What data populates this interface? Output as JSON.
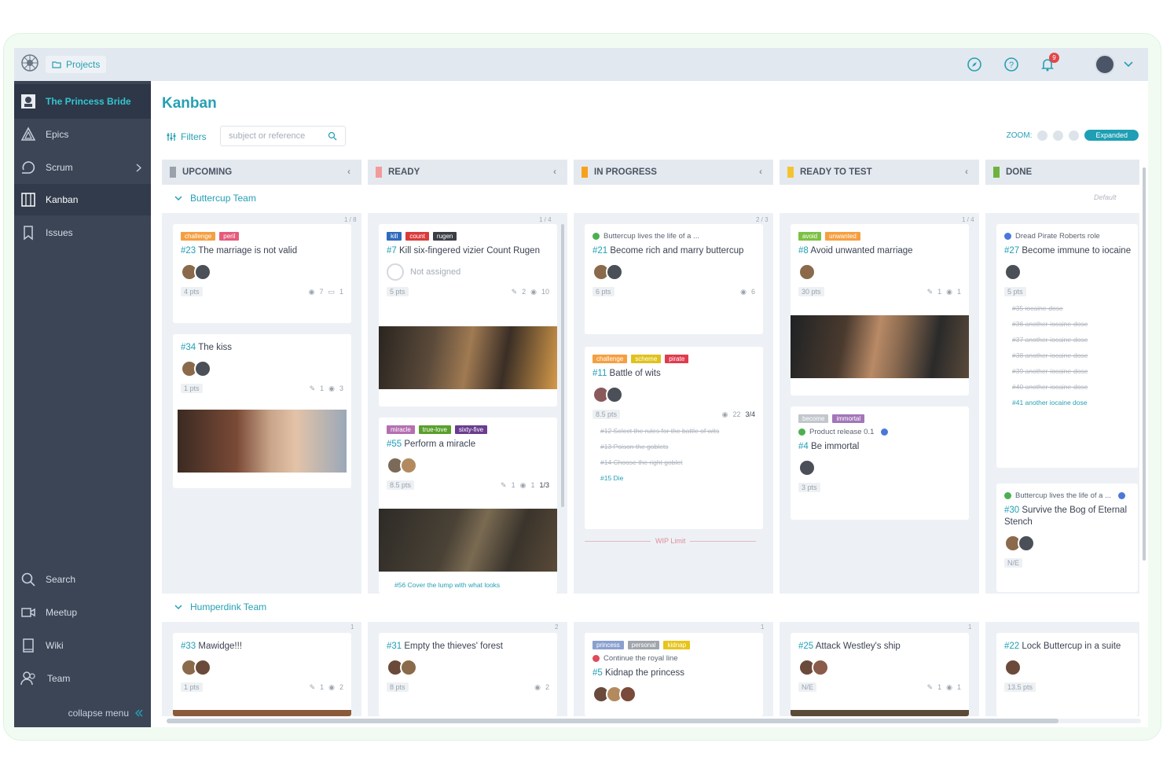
{
  "topbar": {
    "projects_label": "Projects",
    "notifications_count": "9"
  },
  "sidebar": {
    "project_name": "The Princess Bride",
    "items": [
      "Epics",
      "Scrum",
      "Kanban",
      "Issues"
    ],
    "bottom_items": [
      "Search",
      "Meetup",
      "Wiki",
      "Team"
    ],
    "collapse_label": "collapse menu"
  },
  "main": {
    "title": "Kanban",
    "filters_label": "Filters",
    "search_placeholder": "subject or reference",
    "zoom_label": "ZOOM:",
    "zoom_value": "Expanded"
  },
  "columns": [
    {
      "name": "UPCOMING",
      "color": "#9aa1aa"
    },
    {
      "name": "READY",
      "color": "#f29b9b"
    },
    {
      "name": "IN PROGRESS",
      "color": "#f7a21b"
    },
    {
      "name": "READY TO TEST",
      "color": "#f4c430"
    },
    {
      "name": "DONE",
      "color": "#6fb33f"
    }
  ],
  "swimlanes": [
    "Buttercup Team",
    "Humperdink Team"
  ],
  "default_label": "Default",
  "wip_label": "WIP Limit",
  "counters": [
    "1 / 8",
    "1 / 4",
    "2 / 3",
    "1 / 4",
    "1",
    "2",
    "1",
    "1"
  ],
  "cards": {
    "c23": {
      "tags": [
        "challenge",
        "peril"
      ],
      "ref": "#23",
      "title": "The marriage is not valid",
      "pts": "4 pts",
      "watchers": "7",
      "comments": "1"
    },
    "c34": {
      "ref": "#34",
      "title": "The kiss",
      "pts": "1 pts",
      "attachments": "1",
      "watchers": "3"
    },
    "c7": {
      "tags": [
        "kill",
        "count",
        "rugen"
      ],
      "ref": "#7",
      "title": "Kill six-fingered vizier Count Rugen",
      "assigned": "Not assigned",
      "pts": "5 pts",
      "attachments": "2",
      "watchers": "10"
    },
    "c55": {
      "tags": [
        "miracle",
        "true-love",
        "sixty-five"
      ],
      "ref": "#55",
      "title": "Perform a miracle",
      "pts": "8.5 pts",
      "attachments": "1",
      "watchers": "1",
      "tasks": "1/3",
      "subtask": "#56 Cover the lump with what looks"
    },
    "c21": {
      "epic": "Buttercup lives the life of a ...",
      "ref": "#21",
      "title": "Become rich and marry buttercup",
      "pts": "6 pts",
      "watchers": "6"
    },
    "c11": {
      "tags": [
        "challenge",
        "scheme",
        "pirate"
      ],
      "ref": "#11",
      "title": "Battle of wits",
      "pts": "8.5 pts",
      "watchers": "22",
      "tasks": "3/4",
      "subtasks": [
        "#12 Select the rules for the battle of wits",
        "#13 Poison the goblets",
        "#14 Choose the right goblet",
        "#15 Die"
      ]
    },
    "c8": {
      "tags": [
        "avoid",
        "unwanted"
      ],
      "ref": "#8",
      "title": "Avoid unwanted marriage",
      "pts": "30 pts",
      "attachments": "1",
      "watchers": "1"
    },
    "c4": {
      "tags": [
        "become",
        "immortal"
      ],
      "epic": "Product release 0.1",
      "ref": "#4",
      "title": "Be immortal",
      "pts": "3 pts"
    },
    "c27": {
      "epic": "Dread Pirate Roberts role",
      "ref": "#27",
      "title": "Become immune to iocaine",
      "pts": "5 pts",
      "subtasks": [
        "#35 iocaine-dose",
        "#36 another-iocaine-dose",
        "#37 another-iocaine-dose",
        "#38 another-iocaine-dose",
        "#39 another-iocaine-dose",
        "#40 another-iocaine-dose",
        "#41 another iocaine dose"
      ]
    },
    "c30": {
      "epic": "Buttercup lives the life of a ...",
      "ref": "#30",
      "title": "Survive the Bog of Eternal Stench",
      "pts": "N/E"
    },
    "c33": {
      "ref": "#33",
      "title": "Mawidge!!!",
      "pts": "1 pts",
      "attachments": "1",
      "watchers": "2"
    },
    "c31": {
      "ref": "#31",
      "title": "Empty the thieves' forest",
      "pts": "8 pts",
      "watchers": "2"
    },
    "c5": {
      "tags": [
        "princess",
        "personal",
        "kidnap"
      ],
      "epic": "Continue the royal line",
      "ref": "#5",
      "title": "Kidnap the princess"
    },
    "c25": {
      "ref": "#25",
      "title": "Attack Westley's ship",
      "pts": "N/E",
      "attachments": "1",
      "watchers": "1"
    },
    "c22": {
      "ref": "#22",
      "title": "Lock Buttercup in a suite",
      "pts": "13.5 pts"
    }
  }
}
